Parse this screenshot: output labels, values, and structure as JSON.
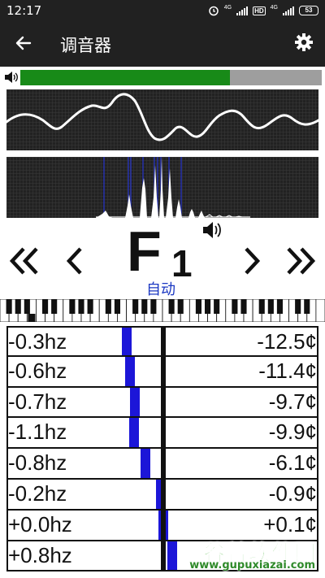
{
  "status_bar": {
    "time": "12:17",
    "network_1": "4G",
    "hd_label": "HD",
    "network_2": "4G",
    "battery": "53"
  },
  "app_bar": {
    "title": "调音器",
    "back_icon": "arrow-left-icon",
    "settings_icon": "gear-icon"
  },
  "volume": {
    "icon": "speaker-icon",
    "level": 0.695,
    "fill_color": "#188a18",
    "track_color": "#9e9e9e"
  },
  "note": {
    "letter": "F",
    "octave": "1",
    "mode": "自动",
    "prev_octave_icon": "double-chevron-left-icon",
    "prev_note_icon": "chevron-left-icon",
    "next_note_icon": "chevron-right-icon",
    "next_octave_icon": "double-chevron-right-icon",
    "play_icon": "speaker-icon"
  },
  "readings": [
    {
      "hz": "-0.3hz",
      "cents": "-12.5¢",
      "offset": -12.5
    },
    {
      "hz": "-0.6hz",
      "cents": "-11.4¢",
      "offset": -11.4
    },
    {
      "hz": "-0.7hz",
      "cents": "-9.7¢",
      "offset": -9.7
    },
    {
      "hz": "-1.1hz",
      "cents": "-9.9¢",
      "offset": -9.9
    },
    {
      "hz": "-0.8hz",
      "cents": "-6.1¢",
      "offset": -6.1
    },
    {
      "hz": "-0.2hz",
      "cents": "-0.9¢",
      "offset": -0.9
    },
    {
      "hz": "+0.0hz",
      "cents": "+0.1¢",
      "offset": 0.1
    },
    {
      "hz": "+0.8hz",
      "cents": "",
      "offset": 3.0
    }
  ],
  "colors": {
    "bar": "#1c16d8",
    "mode_text": "#1a37c2",
    "panel_bg": "#222222"
  },
  "watermark": {
    "title": "谷普软件园",
    "url": "www.gupuxiazai.com"
  }
}
